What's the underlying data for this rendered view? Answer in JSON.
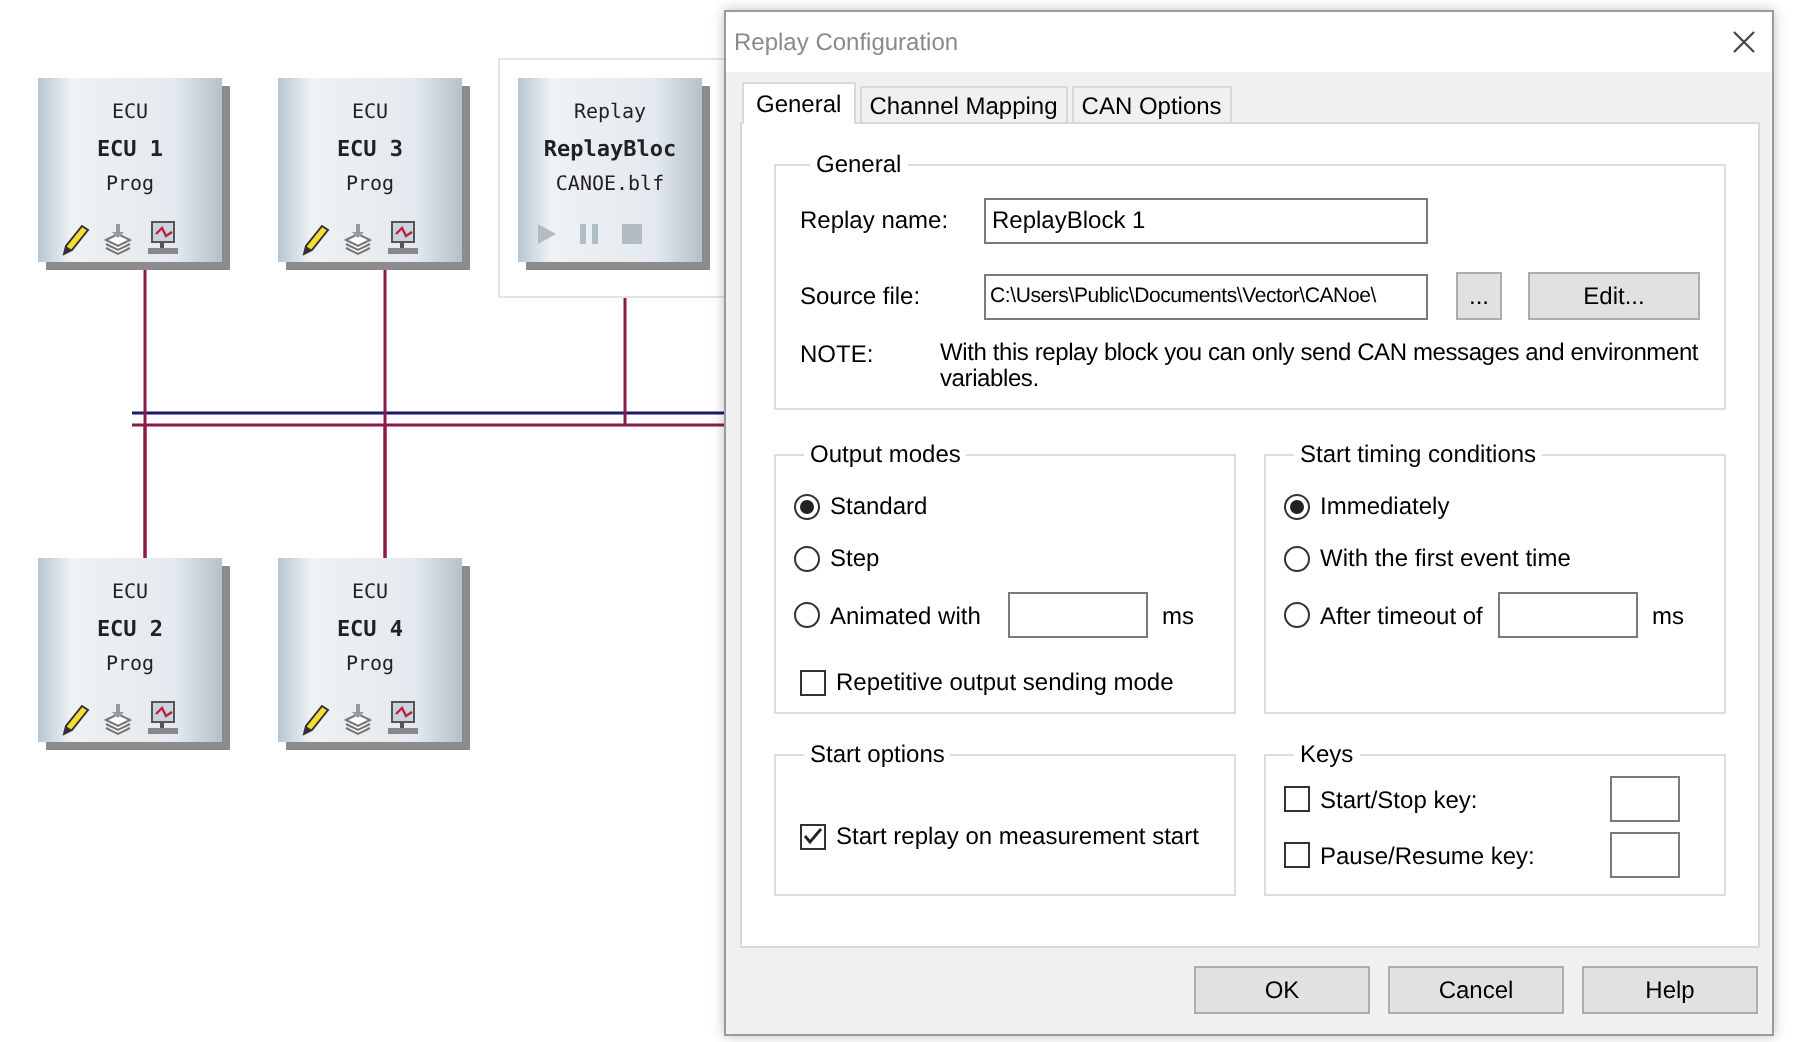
{
  "canvas": {
    "nodes": [
      {
        "kind": "ecu",
        "type_label": "ECU",
        "name": "ECU 1",
        "program": "Prog"
      },
      {
        "kind": "ecu",
        "type_label": "ECU",
        "name": "ECU 3",
        "program": "Prog"
      },
      {
        "kind": "replay",
        "type_label": "Replay",
        "name": "ReplayBloc",
        "file": "CANOE.blf",
        "selected": true
      },
      {
        "kind": "ecu",
        "type_label": "ECU",
        "name": "ECU 2",
        "program": "Prog"
      },
      {
        "kind": "ecu",
        "type_label": "ECU",
        "name": "ECU 4",
        "program": "Prog"
      }
    ]
  },
  "dialog": {
    "title": "Replay Configuration",
    "tabs": [
      {
        "label": "General",
        "selected": true
      },
      {
        "label": "Channel Mapping",
        "selected": false
      },
      {
        "label": "CAN Options",
        "selected": false
      }
    ],
    "general": {
      "title": "General",
      "replay_name": {
        "label": "Replay name:",
        "value": "ReplayBlock 1"
      },
      "source_file": {
        "label": "Source file:",
        "value": "C:\\Users\\Public\\Documents\\Vector\\CANoe\\",
        "browse_button": "...",
        "edit_button": "Edit..."
      },
      "note": {
        "label": "NOTE:",
        "text": "With this replay block you can only send CAN messages and environment variables."
      }
    },
    "output_modes": {
      "title": "Output modes",
      "options": [
        {
          "label": "Standard",
          "selected": true
        },
        {
          "label": "Step",
          "selected": false
        },
        {
          "label": "Animated with",
          "selected": false,
          "unit": "ms"
        }
      ],
      "checkbox": {
        "label": "Repetitive output sending mode",
        "checked": false
      }
    },
    "start_timing": {
      "title": "Start timing conditions",
      "options": [
        {
          "label": "Immediately",
          "selected": true
        },
        {
          "label": "With the first event time",
          "selected": false
        },
        {
          "label": "After timeout of",
          "selected": false,
          "unit": "ms"
        }
      ]
    },
    "start_options": {
      "title": "Start options",
      "checkbox": {
        "label": "Start replay on measurement start",
        "checked": true
      }
    },
    "keys": {
      "title": "Keys",
      "items": [
        {
          "label": "Start/Stop key:",
          "checked": false
        },
        {
          "label": "Pause/Resume key:",
          "checked": false
        }
      ]
    },
    "buttons": [
      "OK",
      "Cancel",
      "Help"
    ]
  }
}
